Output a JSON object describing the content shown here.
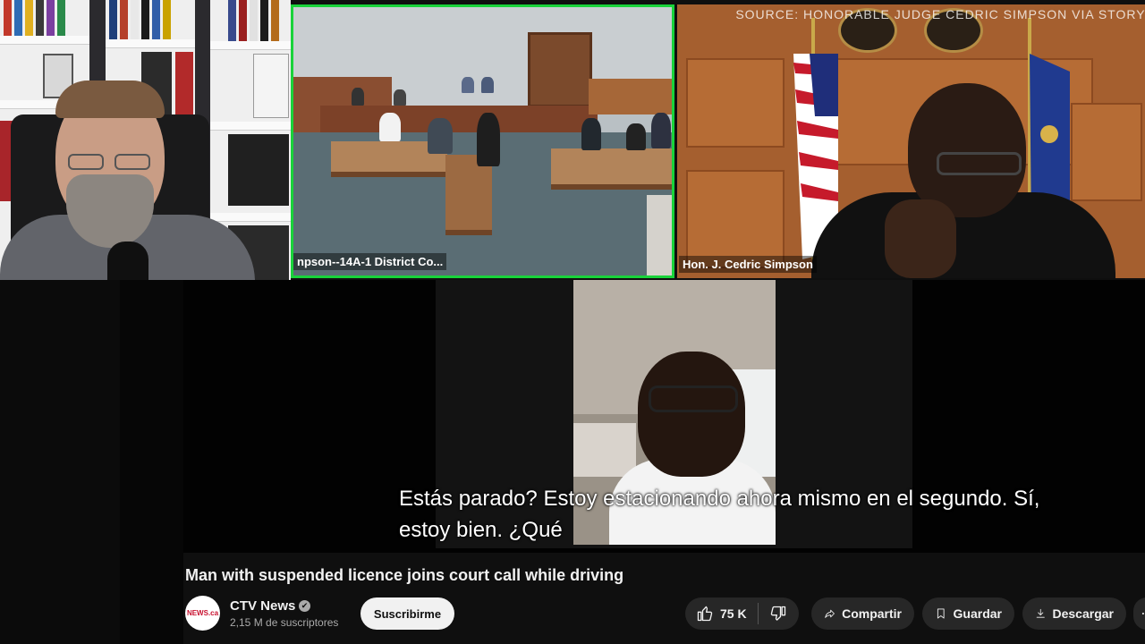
{
  "court_feed": {
    "label": "npson--14A-1 District Co..."
  },
  "judge_feed": {
    "source": "SOURCE: HONORABLE JUDGE CEDRIC SIMPSON VIA STORYFUL",
    "label": "Hon. J. Cedric Simpson"
  },
  "subtitle": {
    "line1": "Estás parado? Estoy estacionando ahora mismo en el segundo. Sí,",
    "line2": "estoy bien. ¿Qué"
  },
  "video": {
    "title": "Man with suspended licence joins court call while driving"
  },
  "channel": {
    "avatar_text": "NEWS.ca",
    "name": "CTV News",
    "verified_icon": "✔",
    "subscribers": "2,15 M de suscriptores",
    "subscribe_label": "Suscribirme"
  },
  "actions": {
    "like_count": "75 K",
    "share_label": "Compartir",
    "save_label": "Guardar",
    "download_label": "Descargar"
  },
  "colors": {
    "active_speaker_border": "#19d33a",
    "background": "#0f0f0f",
    "pill": "#272727"
  },
  "icons": [
    "thumbs-up-icon",
    "thumbs-down-icon",
    "share-icon",
    "bookmark-icon",
    "download-icon",
    "more-icon",
    "verified-icon"
  ]
}
